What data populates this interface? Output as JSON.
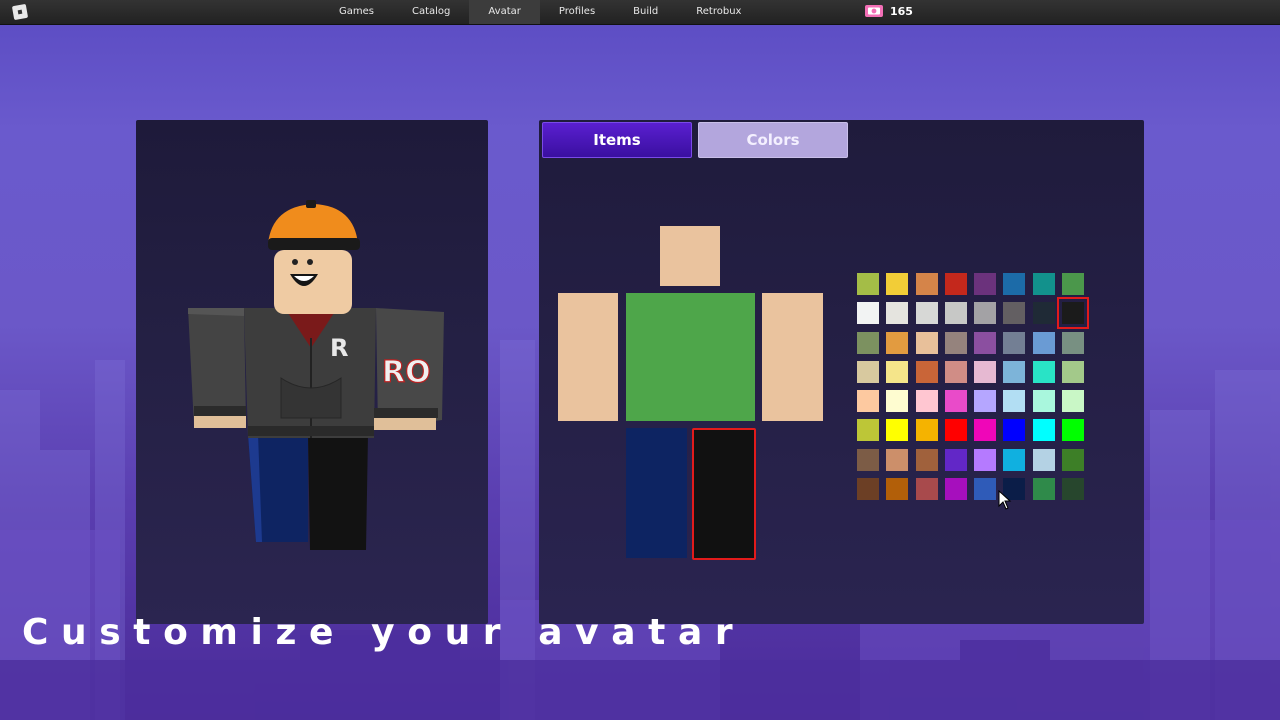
{
  "topbar": {
    "nav": [
      {
        "label": "Games"
      },
      {
        "label": "Catalog"
      },
      {
        "label": "Avatar",
        "active": true
      },
      {
        "label": "Profiles"
      },
      {
        "label": "Build"
      },
      {
        "label": "Retrobux"
      }
    ],
    "currency": {
      "icon": "retrobux-icon",
      "value": "165"
    }
  },
  "tabs": {
    "items_label": "Items",
    "colors_label": "Colors",
    "active": "Items"
  },
  "body_colors": {
    "head": "#eac39e",
    "left_arm": "#eac39e",
    "torso": "#4ea64a",
    "right_arm": "#eac39e",
    "left_leg": "#0d2462",
    "right_leg": "#111111",
    "selected_part": "right_leg"
  },
  "palette": [
    "#a4bd47",
    "#f2cd37",
    "#d58449",
    "#c4281c",
    "#6b327c",
    "#1c6ba8",
    "#12918c",
    "#4b974b",
    "#f2f3f3",
    "#e5e4df",
    "#d7d8d6",
    "#c7c8c6",
    "#a3a2a5",
    "#635f62",
    "#1f2a36",
    "#1b1b1b",
    "#7c9160",
    "#e29b40",
    "#e8c09a",
    "#95837d",
    "#8b4fa0",
    "#737f94",
    "#6a9bd4",
    "#789082",
    "#d8c99f",
    "#f5e58a",
    "#c96538",
    "#d08d86",
    "#e6b9d2",
    "#7db4d9",
    "#29e3c6",
    "#a3c98a",
    "#fdc9a0",
    "#fefcd0",
    "#ffc6d1",
    "#e94bc9",
    "#b5a6ff",
    "#b2def3",
    "#a9f7dd",
    "#c9f7c6",
    "#bdc637",
    "#ffff00",
    "#f5b300",
    "#ff0000",
    "#ef06b8",
    "#0000ff",
    "#00ffff",
    "#00ff00",
    "#7c5c46",
    "#cc8f6a",
    "#a0613c",
    "#6227c7",
    "#b57aff",
    "#10b0e0",
    "#b4d2e4",
    "#3d7f27",
    "#6c3f25",
    "#b25f09",
    "#a84a4c",
    "#a60fbd",
    "#2f5bb8",
    "#0b1d48",
    "#2f8a4a",
    "#27462d"
  ],
  "selected_swatch": 15,
  "caption": "Customize your avatar",
  "avatar": {
    "shirt_text": "RO"
  }
}
